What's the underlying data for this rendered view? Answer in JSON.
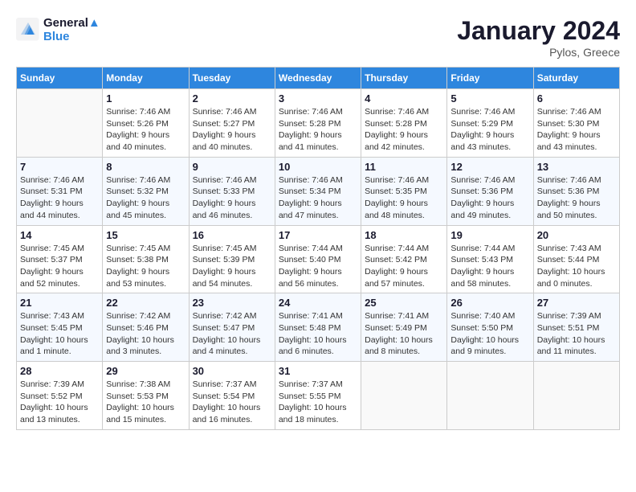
{
  "header": {
    "logo": {
      "line1": "General",
      "line2": "Blue"
    },
    "title": "January 2024",
    "location": "Pylos, Greece"
  },
  "days_of_week": [
    "Sunday",
    "Monday",
    "Tuesday",
    "Wednesday",
    "Thursday",
    "Friday",
    "Saturday"
  ],
  "weeks": [
    [
      {
        "day": "",
        "info": ""
      },
      {
        "day": "1",
        "info": "Sunrise: 7:46 AM\nSunset: 5:26 PM\nDaylight: 9 hours\nand 40 minutes."
      },
      {
        "day": "2",
        "info": "Sunrise: 7:46 AM\nSunset: 5:27 PM\nDaylight: 9 hours\nand 40 minutes."
      },
      {
        "day": "3",
        "info": "Sunrise: 7:46 AM\nSunset: 5:28 PM\nDaylight: 9 hours\nand 41 minutes."
      },
      {
        "day": "4",
        "info": "Sunrise: 7:46 AM\nSunset: 5:28 PM\nDaylight: 9 hours\nand 42 minutes."
      },
      {
        "day": "5",
        "info": "Sunrise: 7:46 AM\nSunset: 5:29 PM\nDaylight: 9 hours\nand 43 minutes."
      },
      {
        "day": "6",
        "info": "Sunrise: 7:46 AM\nSunset: 5:30 PM\nDaylight: 9 hours\nand 43 minutes."
      }
    ],
    [
      {
        "day": "7",
        "info": "Sunrise: 7:46 AM\nSunset: 5:31 PM\nDaylight: 9 hours\nand 44 minutes."
      },
      {
        "day": "8",
        "info": "Sunrise: 7:46 AM\nSunset: 5:32 PM\nDaylight: 9 hours\nand 45 minutes."
      },
      {
        "day": "9",
        "info": "Sunrise: 7:46 AM\nSunset: 5:33 PM\nDaylight: 9 hours\nand 46 minutes."
      },
      {
        "day": "10",
        "info": "Sunrise: 7:46 AM\nSunset: 5:34 PM\nDaylight: 9 hours\nand 47 minutes."
      },
      {
        "day": "11",
        "info": "Sunrise: 7:46 AM\nSunset: 5:35 PM\nDaylight: 9 hours\nand 48 minutes."
      },
      {
        "day": "12",
        "info": "Sunrise: 7:46 AM\nSunset: 5:36 PM\nDaylight: 9 hours\nand 49 minutes."
      },
      {
        "day": "13",
        "info": "Sunrise: 7:46 AM\nSunset: 5:36 PM\nDaylight: 9 hours\nand 50 minutes."
      }
    ],
    [
      {
        "day": "14",
        "info": "Sunrise: 7:45 AM\nSunset: 5:37 PM\nDaylight: 9 hours\nand 52 minutes."
      },
      {
        "day": "15",
        "info": "Sunrise: 7:45 AM\nSunset: 5:38 PM\nDaylight: 9 hours\nand 53 minutes."
      },
      {
        "day": "16",
        "info": "Sunrise: 7:45 AM\nSunset: 5:39 PM\nDaylight: 9 hours\nand 54 minutes."
      },
      {
        "day": "17",
        "info": "Sunrise: 7:44 AM\nSunset: 5:40 PM\nDaylight: 9 hours\nand 56 minutes."
      },
      {
        "day": "18",
        "info": "Sunrise: 7:44 AM\nSunset: 5:42 PM\nDaylight: 9 hours\nand 57 minutes."
      },
      {
        "day": "19",
        "info": "Sunrise: 7:44 AM\nSunset: 5:43 PM\nDaylight: 9 hours\nand 58 minutes."
      },
      {
        "day": "20",
        "info": "Sunrise: 7:43 AM\nSunset: 5:44 PM\nDaylight: 10 hours\nand 0 minutes."
      }
    ],
    [
      {
        "day": "21",
        "info": "Sunrise: 7:43 AM\nSunset: 5:45 PM\nDaylight: 10 hours\nand 1 minute."
      },
      {
        "day": "22",
        "info": "Sunrise: 7:42 AM\nSunset: 5:46 PM\nDaylight: 10 hours\nand 3 minutes."
      },
      {
        "day": "23",
        "info": "Sunrise: 7:42 AM\nSunset: 5:47 PM\nDaylight: 10 hours\nand 4 minutes."
      },
      {
        "day": "24",
        "info": "Sunrise: 7:41 AM\nSunset: 5:48 PM\nDaylight: 10 hours\nand 6 minutes."
      },
      {
        "day": "25",
        "info": "Sunrise: 7:41 AM\nSunset: 5:49 PM\nDaylight: 10 hours\nand 8 minutes."
      },
      {
        "day": "26",
        "info": "Sunrise: 7:40 AM\nSunset: 5:50 PM\nDaylight: 10 hours\nand 9 minutes."
      },
      {
        "day": "27",
        "info": "Sunrise: 7:39 AM\nSunset: 5:51 PM\nDaylight: 10 hours\nand 11 minutes."
      }
    ],
    [
      {
        "day": "28",
        "info": "Sunrise: 7:39 AM\nSunset: 5:52 PM\nDaylight: 10 hours\nand 13 minutes."
      },
      {
        "day": "29",
        "info": "Sunrise: 7:38 AM\nSunset: 5:53 PM\nDaylight: 10 hours\nand 15 minutes."
      },
      {
        "day": "30",
        "info": "Sunrise: 7:37 AM\nSunset: 5:54 PM\nDaylight: 10 hours\nand 16 minutes."
      },
      {
        "day": "31",
        "info": "Sunrise: 7:37 AM\nSunset: 5:55 PM\nDaylight: 10 hours\nand 18 minutes."
      },
      {
        "day": "",
        "info": ""
      },
      {
        "day": "",
        "info": ""
      },
      {
        "day": "",
        "info": ""
      }
    ]
  ]
}
